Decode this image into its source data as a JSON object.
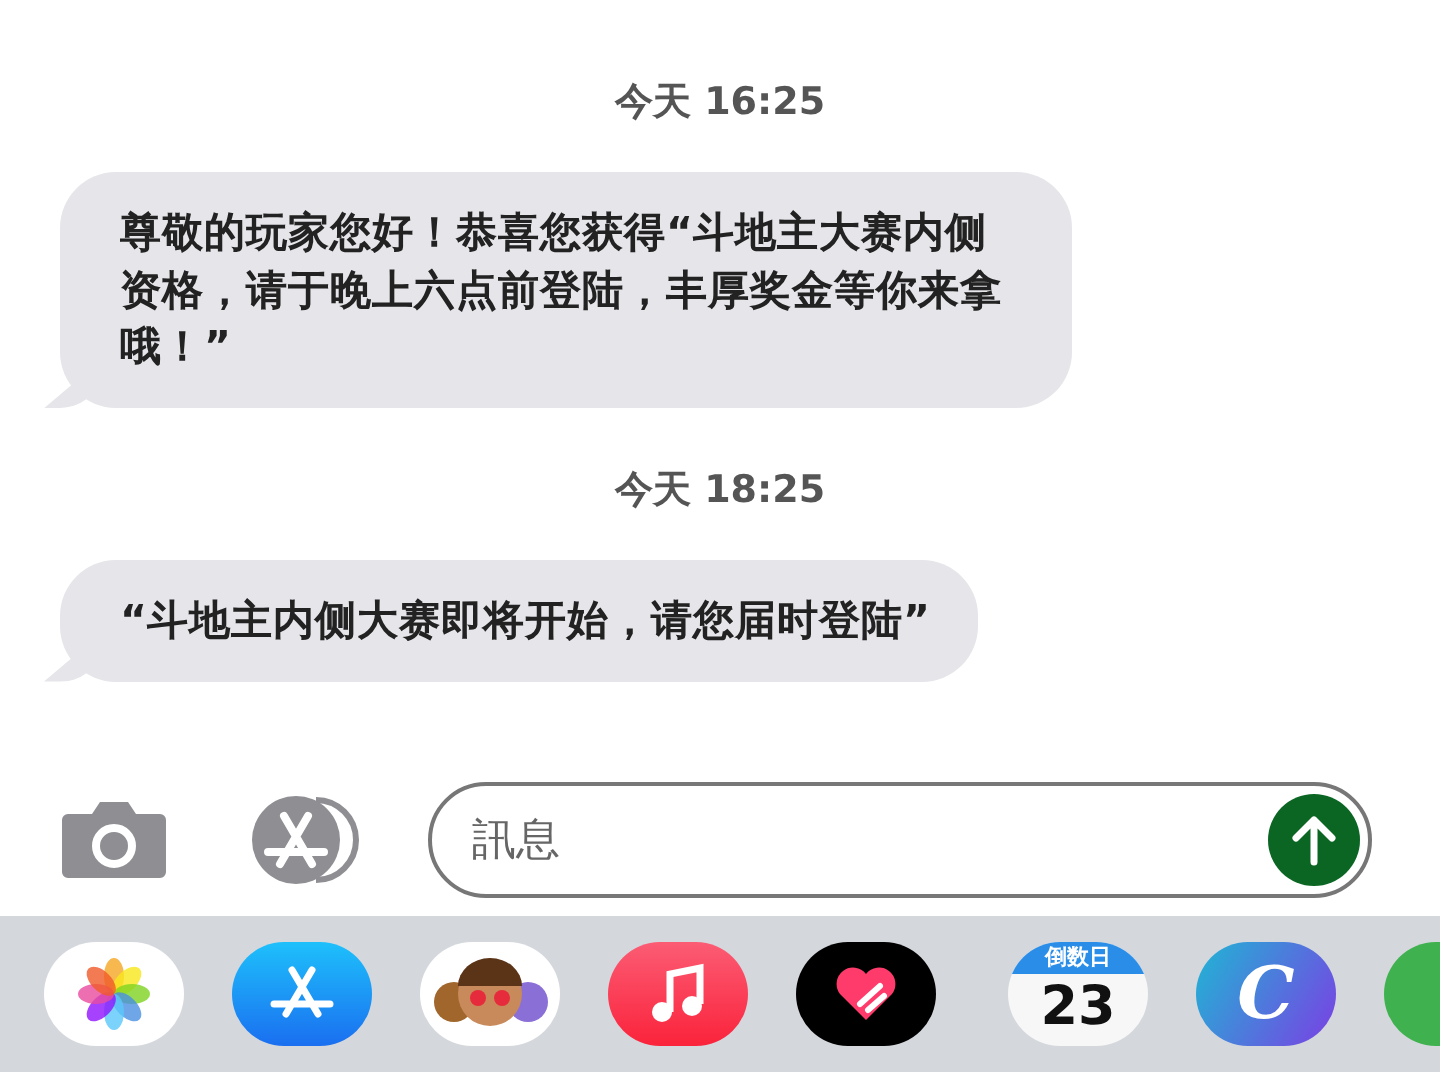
{
  "messages": [
    {
      "kind": "timestamp",
      "text": "今天 16:25"
    },
    {
      "kind": "incoming",
      "text": "尊敬的玩家您好！恭喜您获得“斗地主大赛内侧资格，请于晚上六点前登陆，丰厚奖金等你来拿哦！”"
    },
    {
      "kind": "timestamp",
      "text": "今天 18:25"
    },
    {
      "kind": "incoming",
      "text": "“斗地主内侧大赛即将开始，请您届时登陆”"
    }
  ],
  "composer": {
    "placeholder": "訊息"
  },
  "app_drawer": [
    {
      "kind": "photos"
    },
    {
      "kind": "appstore"
    },
    {
      "kind": "memoji"
    },
    {
      "kind": "music"
    },
    {
      "kind": "fitness"
    },
    {
      "kind": "divider"
    },
    {
      "kind": "calendar",
      "label": "倒数日",
      "day": "23"
    },
    {
      "kind": "letter",
      "letter": "C"
    },
    {
      "kind": "green"
    }
  ]
}
